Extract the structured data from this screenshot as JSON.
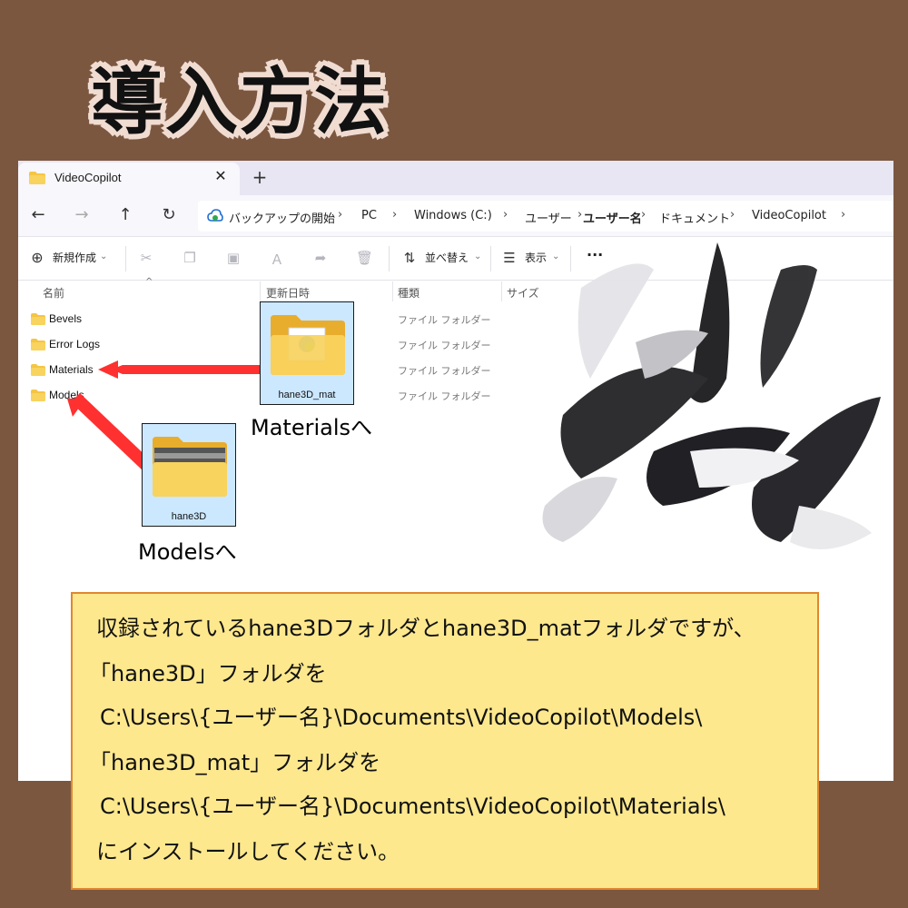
{
  "title": "導入方法",
  "window": {
    "tab_title": "VideoCopilot",
    "tab_close": "✕",
    "new_tab": "+",
    "nav": {
      "back": "←",
      "forward": "→",
      "up": "↑",
      "refresh": "↻"
    },
    "breadcrumb": [
      "バックアップの開始",
      "PC",
      "Windows (C:)",
      "ユーザー",
      "ユーザー名",
      "ドキュメント",
      "VideoCopilot"
    ],
    "toolbar": {
      "new_label": "新規作成",
      "sort_label": "並べ替え",
      "view_label": "表示",
      "more": "···"
    },
    "columns": [
      "名前",
      "更新日時",
      "種類",
      "サイズ"
    ],
    "files": [
      {
        "name": "Bevels",
        "type": "ファイル フォルダー"
      },
      {
        "name": "Error Logs",
        "type": "ファイル フォルダー"
      },
      {
        "name": "Materials",
        "type": "ファイル フォルダー"
      },
      {
        "name": "Models",
        "type": "ファイル フォルダー"
      }
    ]
  },
  "thumbnails": {
    "mat": {
      "label": "hane3D_mat"
    },
    "model": {
      "label": "hane3D"
    }
  },
  "callouts": {
    "materials": "Materialsへ",
    "models": "Modelsへ"
  },
  "info": {
    "line1": "収録されているhane3Dフォルダとhane3D_matフォルダですが、",
    "line2": "「hane3D」フォルダを",
    "line3": "C:\\Users\\{ユーザー名}\\Documents\\VideoCopilot\\Models\\",
    "line4": "「hane3D_mat」フォルダを",
    "line5": "C:\\Users\\{ユーザー名}\\Documents\\VideoCopilot\\Materials\\",
    "line6": "にインストールしてください。"
  },
  "colors": {
    "background": "#7b5740",
    "arrow": "#ff3030",
    "info_bg": "#fde88e",
    "info_border": "#e0872f",
    "thumb_bg": "#cce8ff",
    "folder": "#f5c543"
  }
}
